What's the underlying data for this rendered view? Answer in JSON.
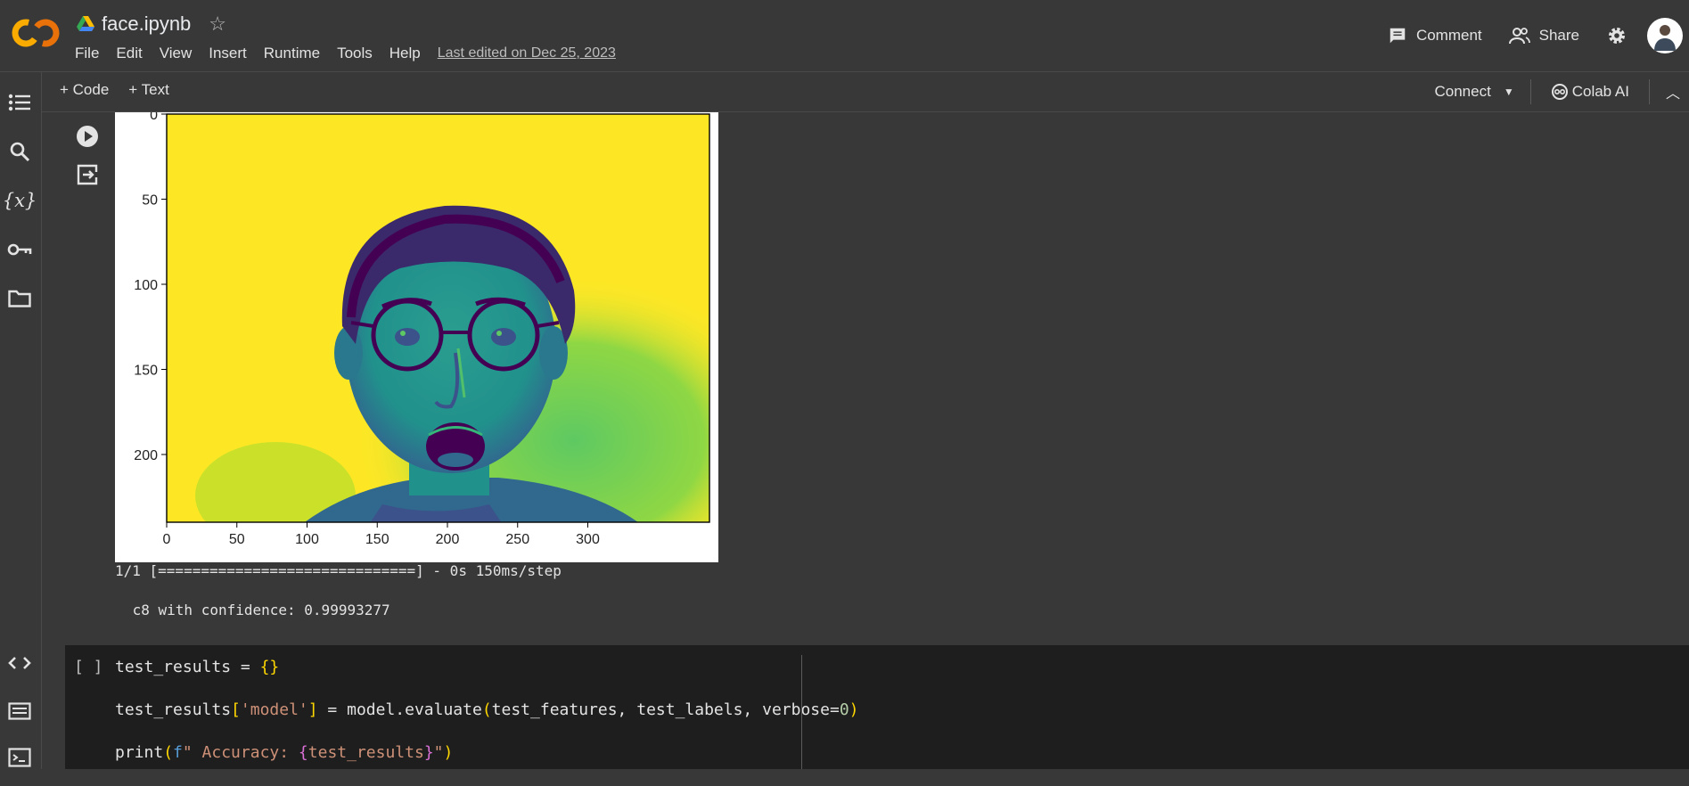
{
  "header": {
    "notebook_title": "face.ipynb",
    "menu": [
      "File",
      "Edit",
      "View",
      "Insert",
      "Runtime",
      "Tools",
      "Help"
    ],
    "last_edited": "Last edited on Dec 25, 2023",
    "comment_label": "Comment",
    "share_label": "Share",
    "accent_color": "#f9ab00"
  },
  "toolbar": {
    "add_code_label": "+ Code",
    "add_text_label": "+ Text",
    "connect_label": "Connect",
    "colab_ai_label": "Colab AI"
  },
  "sidebar": {
    "icons": [
      "table-of-contents-icon",
      "search-icon",
      "variables-icon",
      "secrets-key-icon",
      "files-folder-icon",
      "code-snippets-icon",
      "command-palette-icon",
      "terminal-icon"
    ]
  },
  "output": {
    "progress_line": "1/1 [==============================] - 0s 150ms/step",
    "prediction_line": " c8 with confidence: 0.99993277",
    "plot": {
      "x_ticks": [
        "0",
        "50",
        "100",
        "150",
        "200",
        "250",
        "300"
      ],
      "y_ticks": [
        "0",
        "50",
        "100",
        "150",
        "200"
      ],
      "xlim": [
        0,
        320
      ],
      "ylim": [
        240,
        0
      ],
      "colormap_colors": [
        "#fde725",
        "#21918c",
        "#3b528b",
        "#440154",
        "#5ec962"
      ]
    }
  },
  "code_cell": {
    "bracket": "[ ]",
    "lines": [
      "test_results = {}",
      "test_results['model'] = model.evaluate(test_features, test_labels, verbose=0)",
      "print(f\" Accuracy: {test_results}\")"
    ]
  }
}
